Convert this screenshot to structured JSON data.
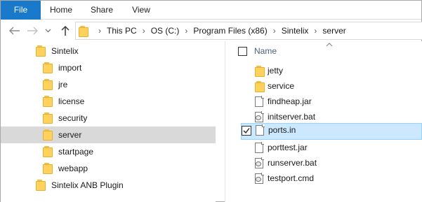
{
  "ribbon": {
    "tabs": [
      {
        "label": "File"
      },
      {
        "label": "Home"
      },
      {
        "label": "Share"
      },
      {
        "label": "View"
      }
    ]
  },
  "address": {
    "crumbs": [
      "This PC",
      "OS (C:)",
      "Program Files (x86)",
      "Sintelix",
      "server"
    ]
  },
  "navigation": {
    "tree": [
      {
        "label": "Sintelix",
        "icon": "folder-icon"
      },
      {
        "label": "import",
        "icon": "folder-icon"
      },
      {
        "label": "jre",
        "icon": "folder-icon"
      },
      {
        "label": "license",
        "icon": "folder-icon"
      },
      {
        "label": "security",
        "icon": "folder-icon"
      },
      {
        "label": "server",
        "icon": "folder-icon",
        "selected": true
      },
      {
        "label": "startpage",
        "icon": "folder-icon"
      },
      {
        "label": "webapp",
        "icon": "folder-icon"
      },
      {
        "label": "Sintelix ANB Plugin",
        "icon": "folder-icon"
      }
    ]
  },
  "file_list": {
    "column_header": "Name",
    "items": [
      {
        "name": "jetty",
        "icon": "folder-icon"
      },
      {
        "name": "service",
        "icon": "folder-icon"
      },
      {
        "name": "findheap.jar",
        "icon": "file-icon"
      },
      {
        "name": "initserver.bat",
        "icon": "batch-file-icon"
      },
      {
        "name": "ports.in",
        "icon": "file-icon",
        "selected": true,
        "checked": true
      },
      {
        "name": "porttest.jar",
        "icon": "file-icon"
      },
      {
        "name": "runserver.bat",
        "icon": "batch-file-icon"
      },
      {
        "name": "testport.cmd",
        "icon": "batch-file-icon"
      }
    ]
  },
  "colors": {
    "file_tab": "#1979ca",
    "selection": "#cce8ff",
    "tree_selection": "#d9d9d9",
    "folder": "#ffd25e",
    "header_text": "#4c607a"
  }
}
